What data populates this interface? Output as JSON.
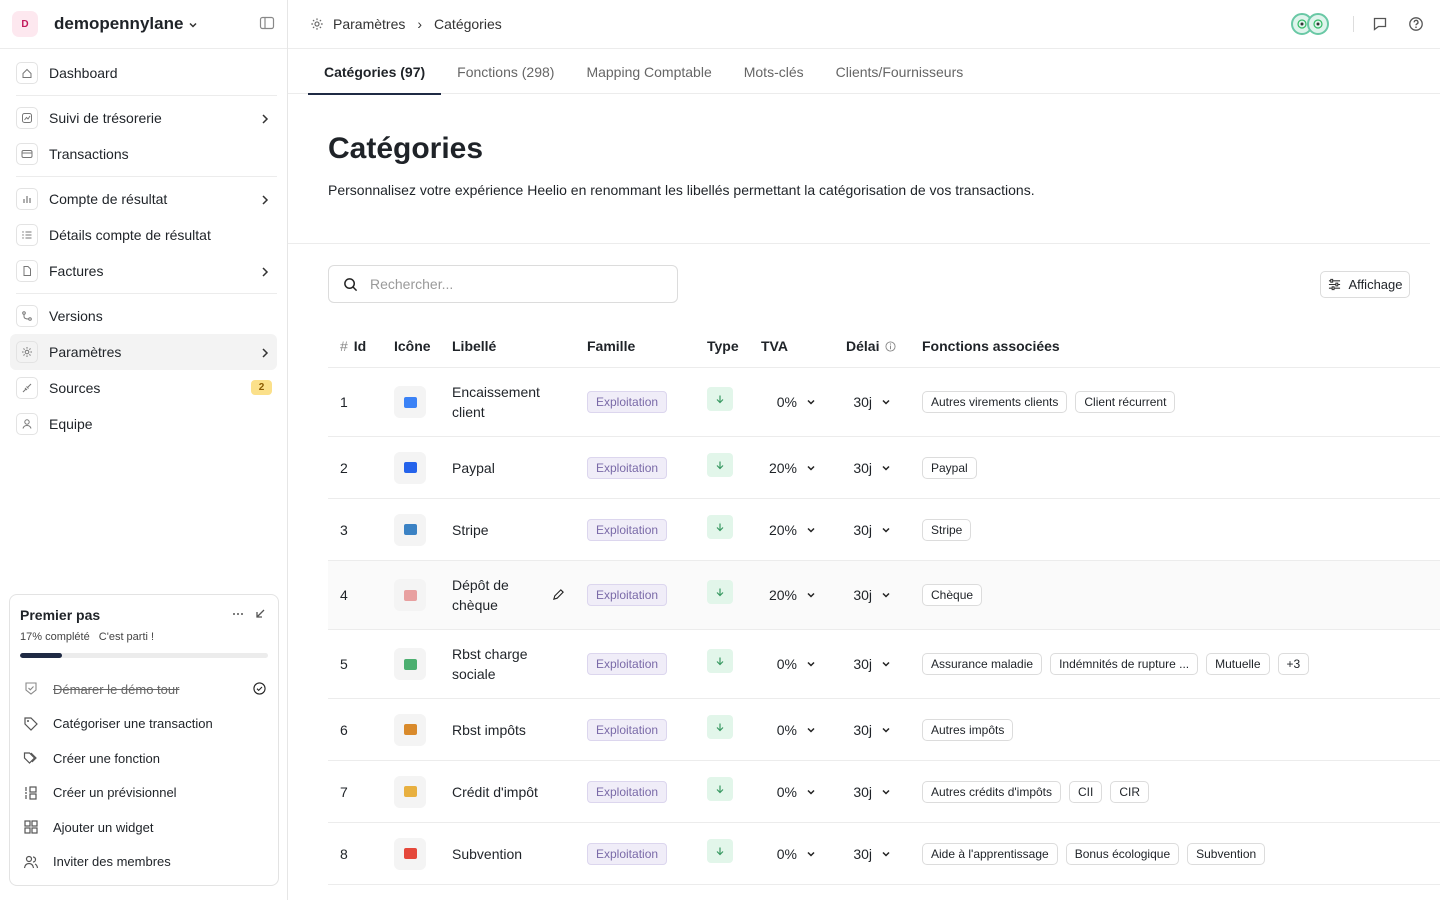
{
  "workspace": {
    "initial": "D",
    "name": "demopennylane"
  },
  "nav": [
    {
      "label": "Dashboard",
      "icon": "home-icon"
    },
    {
      "label": "Suivi de trésorerie",
      "icon": "chart-icon",
      "chevron": true
    },
    {
      "label": "Transactions",
      "icon": "card-icon"
    },
    {
      "label": "Compte de résultat",
      "icon": "bar-chart-icon",
      "chevron": true
    },
    {
      "label": "Détails compte de résultat",
      "icon": "list-icon"
    },
    {
      "label": "Factures",
      "icon": "file-icon",
      "chevron": true
    },
    {
      "label": "Versions",
      "icon": "branch-icon"
    },
    {
      "label": "Paramètres",
      "icon": "gear-icon",
      "chevron": true,
      "active": true
    },
    {
      "label": "Sources",
      "icon": "plug-icon",
      "badge": "2"
    },
    {
      "label": "Equipe",
      "icon": "user-icon"
    }
  ],
  "onboarding": {
    "title": "Premier pas",
    "progress_label": "17% complété",
    "status": "C'est parti !",
    "progress": 0.17,
    "items": [
      {
        "label": "Démarer le démo tour",
        "done": true,
        "icon": "badge-icon"
      },
      {
        "label": "Catégoriser une transaction",
        "icon": "tag-icon"
      },
      {
        "label": "Créer une fonction",
        "icon": "tags-icon"
      },
      {
        "label": "Créer un prévisionnel",
        "icon": "forecast-icon"
      },
      {
        "label": "Ajouter un widget",
        "icon": "widget-icon"
      },
      {
        "label": "Inviter des membres",
        "icon": "users-icon"
      }
    ]
  },
  "breadcrumb": {
    "root": "Paramètres",
    "current": "Catégories"
  },
  "tabs": [
    {
      "label": "Catégories (97)",
      "active": true
    },
    {
      "label": "Fonctions (298)"
    },
    {
      "label": "Mapping Comptable"
    },
    {
      "label": "Mots-clés"
    },
    {
      "label": "Clients/Fournisseurs"
    }
  ],
  "page": {
    "title": "Catégories",
    "description": "Personnalisez votre expérience Heelio en renommant les libellés permettant la catégorisation de vos transactions."
  },
  "search": {
    "placeholder": "Rechercher...",
    "value": ""
  },
  "affichage_label": "Affichage",
  "table": {
    "headers": {
      "hash": "#",
      "id": "Id",
      "icon": "Icône",
      "label": "Libellé",
      "family": "Famille",
      "type": "Type",
      "tva": "TVA",
      "delay": "Délai",
      "functions": "Fonctions associées"
    },
    "rows": [
      {
        "id": "1",
        "icon": "transfer-icon",
        "icon_color": "#3b82f6",
        "label": "Encaissement client",
        "family": "Exploitation",
        "tva": "0%",
        "delay": "30j",
        "functions": [
          "Autres virements clients",
          "Client récurrent"
        ]
      },
      {
        "id": "2",
        "icon": "paypal-icon",
        "icon_color": "#2563eb",
        "label": "Paypal",
        "family": "Exploitation",
        "tva": "20%",
        "delay": "30j",
        "functions": [
          "Paypal"
        ]
      },
      {
        "id": "3",
        "icon": "credit-card-icon",
        "icon_color": "#3b82c4",
        "label": "Stripe",
        "family": "Exploitation",
        "tva": "20%",
        "delay": "30j",
        "functions": [
          "Stripe"
        ]
      },
      {
        "id": "4",
        "icon": "cheque-icon",
        "icon_color": "#e8a0a0",
        "label": "Dépôt de chèque",
        "family": "Exploitation",
        "tva": "20%",
        "delay": "30j",
        "functions": [
          "Chèque"
        ],
        "hover": true
      },
      {
        "id": "5",
        "icon": "social-charge-icon",
        "icon_color": "#4caf70",
        "label": "Rbst charge sociale",
        "family": "Exploitation",
        "tva": "0%",
        "delay": "30j",
        "functions": [
          "Assurance maladie",
          "Indémnités de rupture ...",
          "Mutuelle",
          "+3"
        ]
      },
      {
        "id": "6",
        "icon": "money-bag-icon",
        "icon_color": "#d98a2b",
        "label": "Rbst impôts",
        "family": "Exploitation",
        "tva": "0%",
        "delay": "30j",
        "functions": [
          "Autres impôts"
        ]
      },
      {
        "id": "7",
        "icon": "tax-credit-icon",
        "icon_color": "#e8b040",
        "label": "Crédit d'impôt",
        "family": "Exploitation",
        "tva": "0%",
        "delay": "30j",
        "functions": [
          "Autres crédits d'impôts",
          "CII",
          "CIR"
        ]
      },
      {
        "id": "8",
        "icon": "gift-icon",
        "icon_color": "#e5483b",
        "label": "Subvention",
        "family": "Exploitation",
        "tva": "0%",
        "delay": "30j",
        "functions": [
          "Aide à l'apprentissage",
          "Bonus écologique",
          "Subvention"
        ]
      }
    ]
  }
}
